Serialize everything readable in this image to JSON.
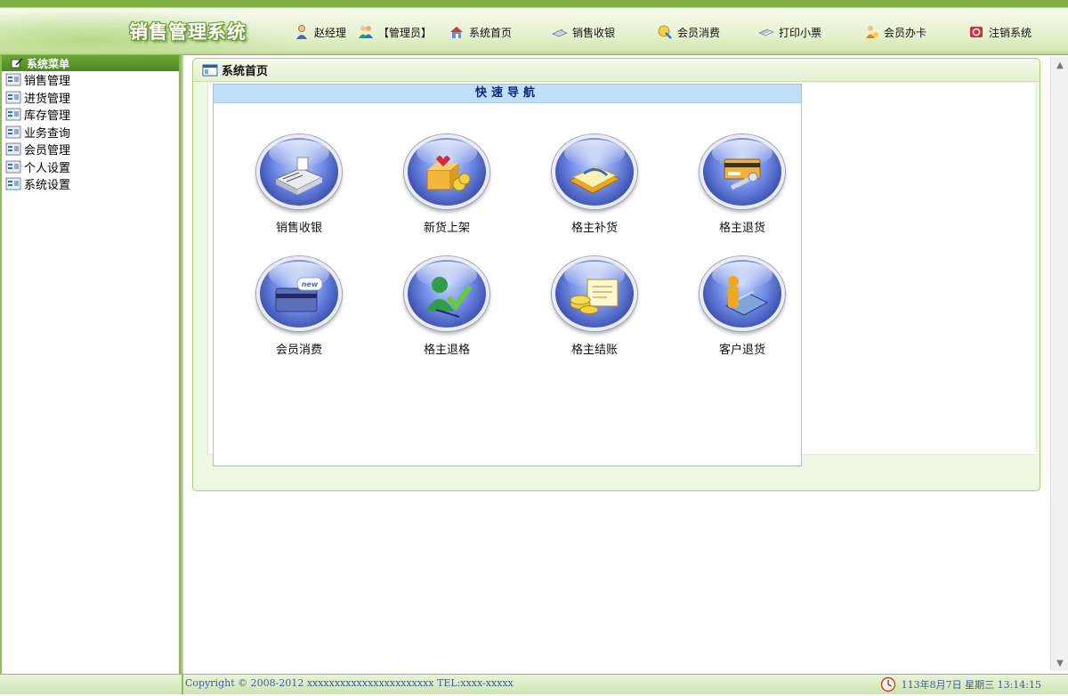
{
  "app": {
    "title": "销售管理系统"
  },
  "topnav": {
    "user_name": "赵经理",
    "user_role": "【管理员】",
    "items": [
      {
        "label": "系统首页",
        "icon": "home-icon"
      },
      {
        "label": "销售收银",
        "icon": "cashier-icon"
      },
      {
        "label": "会员消费",
        "icon": "member-spend-icon"
      },
      {
        "label": "打印小票",
        "icon": "print-icon"
      },
      {
        "label": "会员办卡",
        "icon": "member-card-icon"
      },
      {
        "label": "注销系统",
        "icon": "logout-icon"
      }
    ]
  },
  "sidebar": {
    "title": "系统菜单",
    "items": [
      {
        "label": "销售管理"
      },
      {
        "label": "进货管理"
      },
      {
        "label": "库存管理"
      },
      {
        "label": "业务查询"
      },
      {
        "label": "会员管理"
      },
      {
        "label": "个人设置"
      },
      {
        "label": "系统设置"
      }
    ]
  },
  "main": {
    "panel_title": "系统首页",
    "quicknav": {
      "title": "快速导航",
      "tiles": [
        {
          "label": "销售收银",
          "icon": "cash-register-icon"
        },
        {
          "label": "新货上架",
          "icon": "new-goods-icon"
        },
        {
          "label": "格主补货",
          "icon": "restock-icon"
        },
        {
          "label": "格主退货",
          "icon": "return-goods-icon"
        },
        {
          "label": "会员消费",
          "icon": "member-card-new-icon"
        },
        {
          "label": "格主退格",
          "icon": "cancel-shelf-icon"
        },
        {
          "label": "格主结账",
          "icon": "settlement-icon"
        },
        {
          "label": "客户退货",
          "icon": "customer-return-icon"
        }
      ]
    }
  },
  "footer": {
    "copyright": "Copyright © 2008-2012 xxxxxxxxxxxxxxxxxxxxxxx TEL:xxxx-xxxxx",
    "datetime": "113年8月7日 星期三 13:14:15"
  },
  "colors": {
    "accent_green": "#7fb23f",
    "quicknav_header": "#bfe0fb",
    "tile_blue": "#3b4fb8"
  }
}
